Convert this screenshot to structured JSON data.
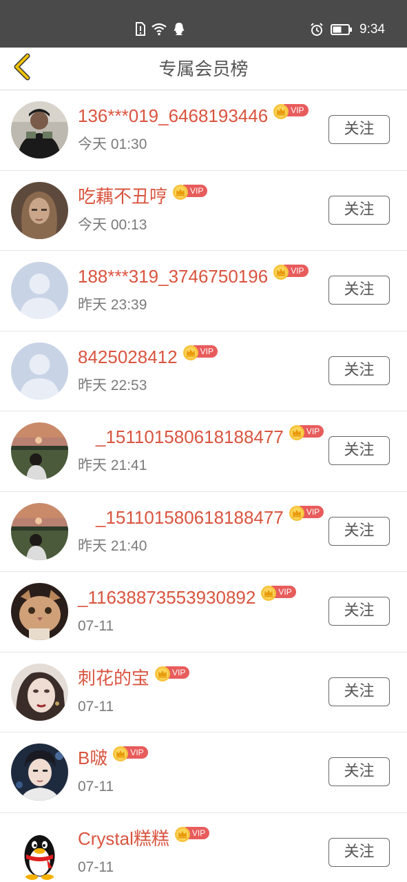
{
  "status_bar": {
    "time": "9:34",
    "icons": [
      "sim-alert-icon",
      "wifi-icon",
      "qq-notification-icon",
      "alarm-icon",
      "battery-icon"
    ]
  },
  "nav": {
    "title": "专属会员榜",
    "back_icon": "chevron-left-icon"
  },
  "colors": {
    "status_bar_bg": "#4a4a4a",
    "name_color": "#d9543f",
    "vip_tag": "#e85c5c",
    "crown": "#f5b82e",
    "back_arrow": "#e0a800"
  },
  "vip_label": "VIP",
  "follow_label": "关注",
  "members": [
    {
      "name": "136***019_6468193446",
      "time": "今天 01:30",
      "avatar": "photo-man-cap"
    },
    {
      "name": "吃藕不丑哼",
      "time": "今天 00:13",
      "avatar": "photo-woman"
    },
    {
      "name": "188***319_3746750196",
      "time": "昨天 23:39",
      "avatar": "default-avatar"
    },
    {
      "name": "8425028412",
      "time": "昨天 22:53",
      "avatar": "default-avatar"
    },
    {
      "name": "　_151101580618188477",
      "time": "昨天 21:41",
      "avatar": "photo-sunset"
    },
    {
      "name": "　_151101580618188477",
      "time": "昨天 21:40",
      "avatar": "photo-sunset"
    },
    {
      "name": "_11638873553930892",
      "time": "07-11",
      "avatar": "photo-cat"
    },
    {
      "name": "刺花的宝",
      "time": "07-11",
      "avatar": "photo-woman-face"
    },
    {
      "name": "B啵",
      "time": "07-11",
      "avatar": "photo-young-man"
    },
    {
      "name": "Crystal糕糕",
      "time": "07-11",
      "avatar": "qq-penguin"
    }
  ]
}
